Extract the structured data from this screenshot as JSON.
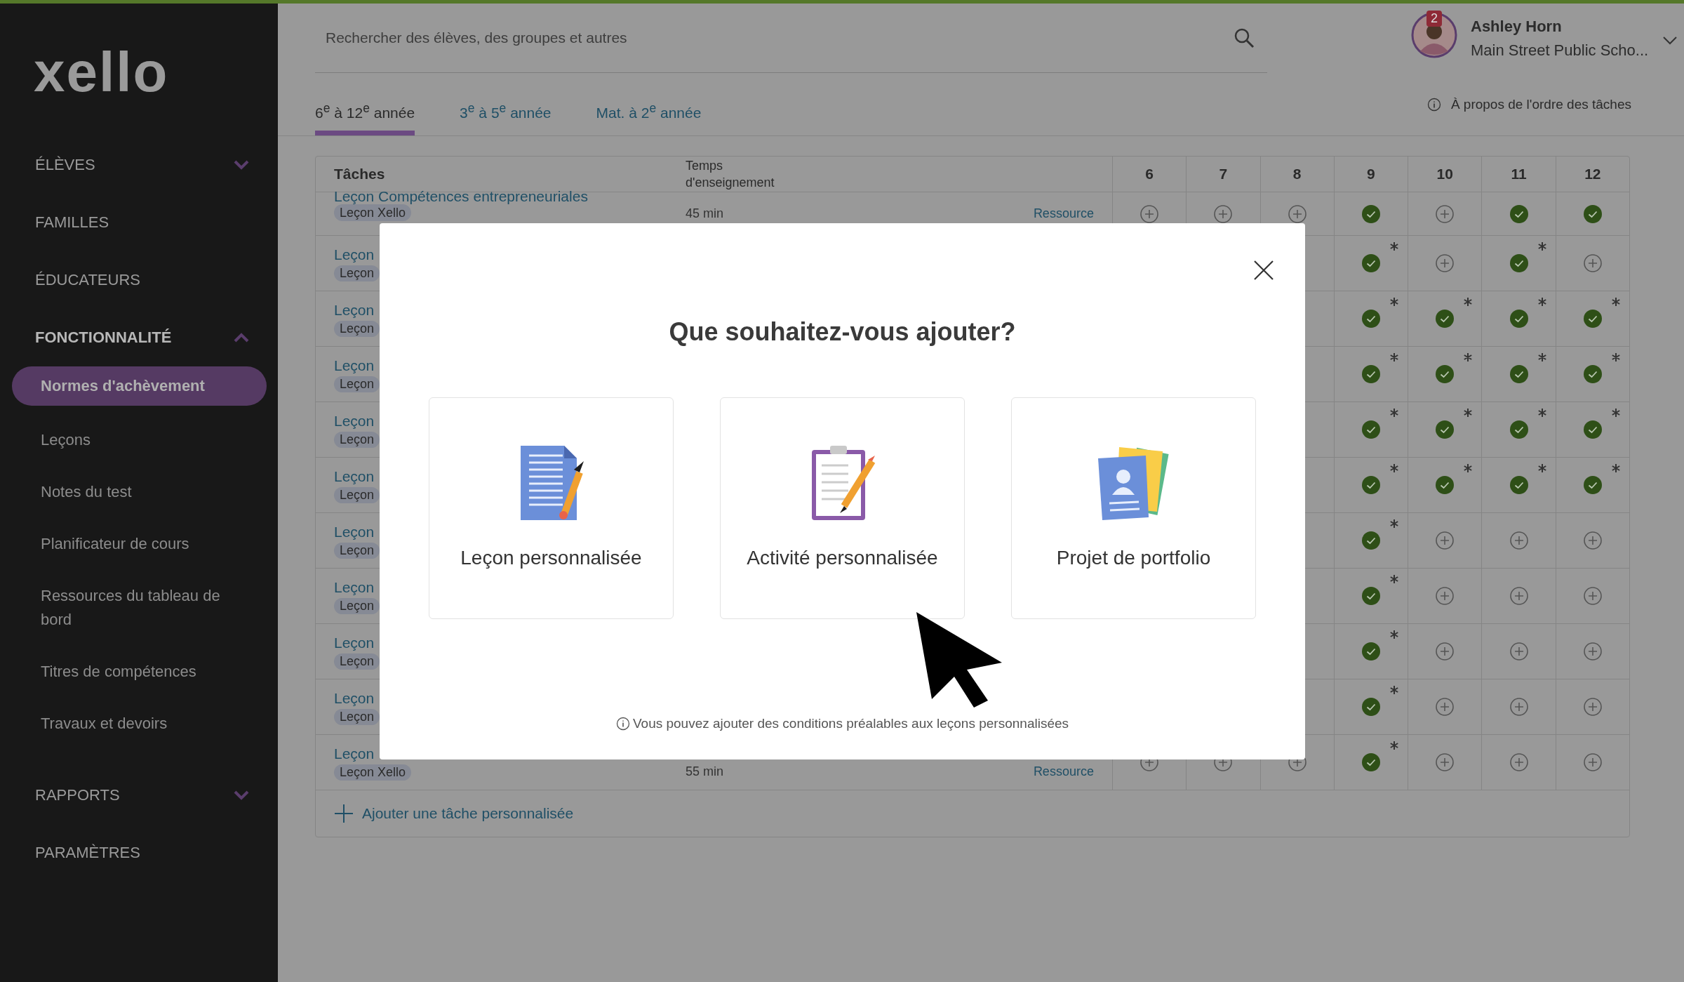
{
  "logo": "xello",
  "sidebar": {
    "items": [
      {
        "kind": "group",
        "label": "ÉLÈVES",
        "expanded": false
      },
      {
        "kind": "link",
        "label": "FAMILLES"
      },
      {
        "kind": "link",
        "label": "ÉDUCATEURS"
      },
      {
        "kind": "group",
        "label": "FONCTIONNALITÉ",
        "expanded": true,
        "children": [
          {
            "label": "Normes d'achèvement",
            "selected": true
          },
          {
            "label": "Leçons",
            "selected": false
          },
          {
            "label": "Notes du test",
            "selected": false
          },
          {
            "label": "Planificateur de cours",
            "selected": false
          },
          {
            "label": "Ressources du tableau de bord",
            "selected": false
          },
          {
            "label": "Titres de compétences",
            "selected": false
          },
          {
            "label": "Travaux et devoirs",
            "selected": false
          }
        ]
      },
      {
        "kind": "group",
        "label": "RAPPORTS",
        "expanded": false
      },
      {
        "kind": "link",
        "label": "PARAMÈTRES"
      }
    ]
  },
  "search": {
    "placeholder": "Rechercher des élèves, des groupes et autres"
  },
  "user": {
    "name": "Ashley Horn",
    "school": "Main Street Public Scho...",
    "notifications": "2"
  },
  "tabs": [
    {
      "label": "6$^{e}$ à 12$^{e}$ année",
      "selected": true
    },
    {
      "label": "3$^{e}$ à 5$^{e}$ année",
      "selected": false
    },
    {
      "label": "Mat. à 2$^{e}$ année",
      "selected": false
    }
  ],
  "info_link": "À propos de l'ordre des tâches",
  "table": {
    "columns": [
      "Tâches",
      "Temps d'enseignement",
      "6",
      "7",
      "8",
      "9",
      "10",
      "11",
      "12"
    ],
    "rows": [
      {
        "name": "Leçon Compétences entrepreneuriales",
        "tag": "Leçon Xello",
        "time": "45 min",
        "resource": "Ressource",
        "cells": [
          {
            "done": false,
            "starred": false
          },
          {
            "done": false,
            "starred": false
          },
          {
            "done": false,
            "starred": false
          },
          {
            "done": true,
            "starred": false
          },
          {
            "done": false,
            "starred": false
          },
          {
            "done": true,
            "starred": false
          },
          {
            "done": true,
            "starred": false
          }
        ]
      },
      {
        "name": "Leçon",
        "tag": "Leçon",
        "cells": [
          {
            "done": true,
            "starred": true
          },
          {
            "done": false,
            "starred": false
          },
          {
            "done": true,
            "starred": true
          },
          {
            "done": false,
            "starred": false
          }
        ]
      },
      {
        "name": "Leçon",
        "tag": "Leçon",
        "cells": [
          {
            "done": true,
            "starred": true
          },
          {
            "done": true,
            "starred": true
          },
          {
            "done": true,
            "starred": true
          },
          {
            "done": true,
            "starred": true
          }
        ]
      },
      {
        "name": "Leçon",
        "tag": "Leçon",
        "cells": [
          {
            "done": true,
            "starred": true
          },
          {
            "done": true,
            "starred": true
          },
          {
            "done": true,
            "starred": true
          },
          {
            "done": true,
            "starred": true
          }
        ]
      },
      {
        "name": "Leçon",
        "tag": "Leçon",
        "cells": [
          {
            "done": true,
            "starred": true
          },
          {
            "done": true,
            "starred": true
          },
          {
            "done": true,
            "starred": true
          },
          {
            "done": true,
            "starred": true
          }
        ]
      },
      {
        "name": "Leçon",
        "tag": "Leçon",
        "cells": [
          {
            "done": true,
            "starred": true
          },
          {
            "done": true,
            "starred": true
          },
          {
            "done": true,
            "starred": true
          },
          {
            "done": true,
            "starred": true
          }
        ]
      },
      {
        "name": "Leçon",
        "tag": "Leçon",
        "cells": [
          {
            "done": true,
            "starred": true
          },
          {
            "done": false,
            "starred": false
          },
          {
            "done": false,
            "starred": false
          },
          {
            "done": false,
            "starred": false
          }
        ]
      },
      {
        "name": "Leçon",
        "tag": "Leçon",
        "cells": [
          {
            "done": true,
            "starred": true
          },
          {
            "done": false,
            "starred": false
          },
          {
            "done": false,
            "starred": false
          },
          {
            "done": false,
            "starred": false
          }
        ]
      },
      {
        "name": "Leçon",
        "tag": "Leçon",
        "cells": [
          {
            "done": true,
            "starred": true
          },
          {
            "done": false,
            "starred": false
          },
          {
            "done": false,
            "starred": false
          },
          {
            "done": false,
            "starred": false
          }
        ]
      },
      {
        "name": "Leçon",
        "tag": "Leçon",
        "cells": [
          {
            "done": true,
            "starred": true
          },
          {
            "done": false,
            "starred": false
          },
          {
            "done": false,
            "starred": false
          },
          {
            "done": false,
            "starred": false
          }
        ]
      },
      {
        "name": "Leçon",
        "tag": "Leçon Xello",
        "time": "55 min",
        "resource": "Ressource",
        "cells": [
          {
            "done": false
          },
          {
            "done": false
          },
          {
            "done": false
          },
          {
            "done": true,
            "starred": true
          },
          {
            "done": false,
            "starred": false
          },
          {
            "done": false,
            "starred": false
          },
          {
            "done": false,
            "starred": false
          }
        ]
      }
    ],
    "add_task": "Ajouter une tâche personnalisée"
  },
  "modal": {
    "title": "Que souhaitez-vous ajouter?",
    "options": [
      {
        "kind": "document",
        "label": "Leçon personnalisée"
      },
      {
        "kind": "clipboard",
        "label": "Activité personnalisée"
      },
      {
        "kind": "portfolio",
        "label": "Projet de portfolio"
      }
    ],
    "note": "Vous pouvez ajouter des conditions préalables aux leçons personnalisées"
  }
}
